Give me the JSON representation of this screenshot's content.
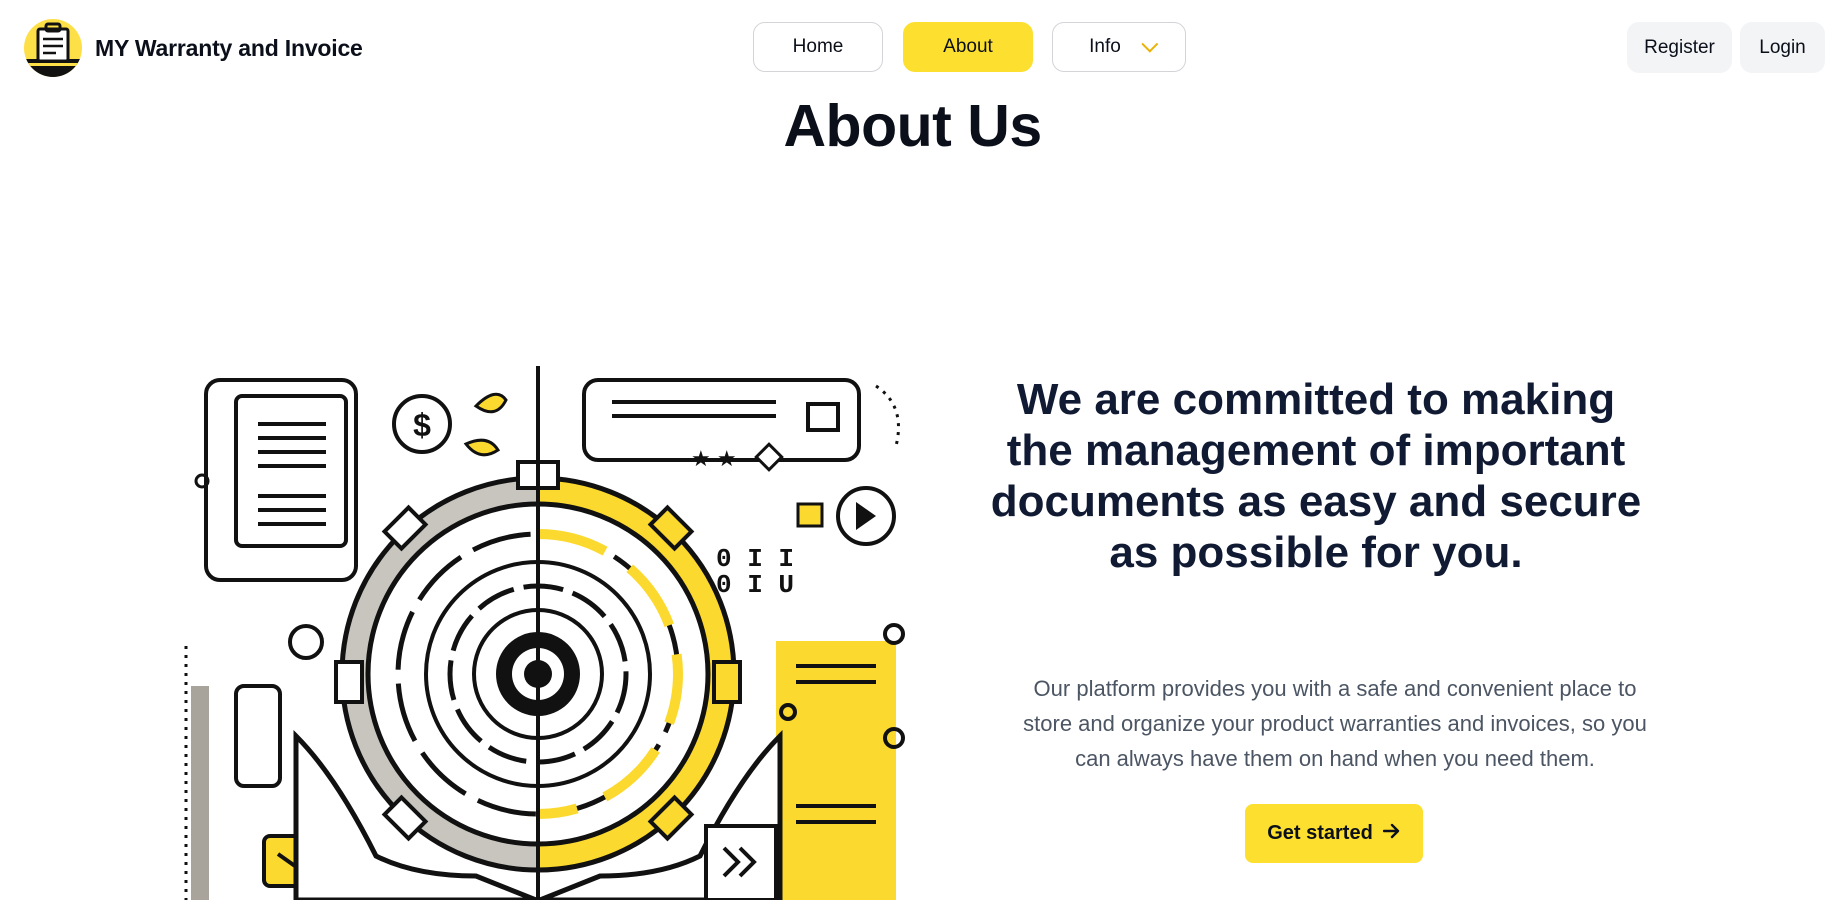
{
  "brand": {
    "name": "MY Warranty and Invoice",
    "logo_icon": "briefcase-logo-icon",
    "accent": "#fde047"
  },
  "nav": {
    "items": [
      {
        "label": "Home"
      },
      {
        "label": "About",
        "active": true
      },
      {
        "label": "Info",
        "has_dropdown": true
      }
    ]
  },
  "auth": {
    "register_label": "Register",
    "login_label": "Login"
  },
  "page": {
    "title": "About Us"
  },
  "hero": {
    "illustration_icon": "gear-hands-illustration",
    "headline": "We are committed to making the management of important documents as easy and secure as possible for you.",
    "description": "Our platform provides you with a safe and convenient place to store and organize your product warranties and invoices, so you can always have them on hand when you need them.",
    "cta_label": "Get started",
    "cta_icon": "arrow-right-icon"
  },
  "colors": {
    "accent": "#fde02f",
    "text_dark": "#0b0f19",
    "text_muted": "#4b5563",
    "button_gray": "#f3f4f6"
  }
}
